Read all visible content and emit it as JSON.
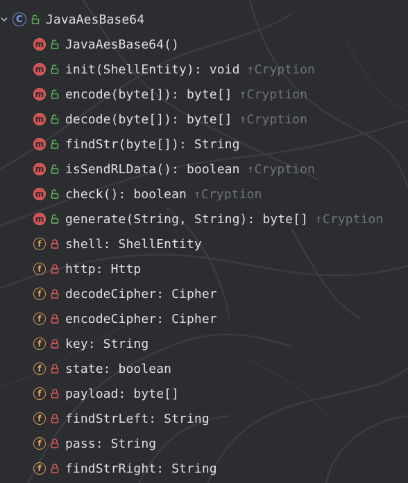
{
  "tree": {
    "root": {
      "label": "JavaAesBase64",
      "kind_icon": "class-icon",
      "visibility_icon": "public-icon",
      "expand_icon": "chevron-down-icon",
      "badge": "C"
    },
    "members": [
      {
        "label": "JavaAesBase64()",
        "super": "",
        "kind": "method",
        "visibility": "public"
      },
      {
        "label": "init(ShellEntity): void",
        "super": "↑Cryption",
        "kind": "method",
        "visibility": "public"
      },
      {
        "label": "encode(byte[]): byte[]",
        "super": "↑Cryption",
        "kind": "method",
        "visibility": "public"
      },
      {
        "label": "decode(byte[]): byte[]",
        "super": "↑Cryption",
        "kind": "method",
        "visibility": "public"
      },
      {
        "label": "findStr(byte[]): String",
        "super": "",
        "kind": "method",
        "visibility": "public"
      },
      {
        "label": "isSendRLData(): boolean",
        "super": "↑Cryption",
        "kind": "method",
        "visibility": "public"
      },
      {
        "label": "check(): boolean",
        "super": "↑Cryption",
        "kind": "method",
        "visibility": "public"
      },
      {
        "label": "generate(String, String): byte[]",
        "super": "↑Cryption",
        "kind": "method",
        "visibility": "public"
      },
      {
        "label": "shell: ShellEntity",
        "super": "",
        "kind": "field",
        "visibility": "private"
      },
      {
        "label": "http: Http",
        "super": "",
        "kind": "field",
        "visibility": "private"
      },
      {
        "label": "decodeCipher: Cipher",
        "super": "",
        "kind": "field",
        "visibility": "private"
      },
      {
        "label": "encodeCipher: Cipher",
        "super": "",
        "kind": "field",
        "visibility": "private"
      },
      {
        "label": "key: String",
        "super": "",
        "kind": "field",
        "visibility": "private"
      },
      {
        "label": "state: boolean",
        "super": "",
        "kind": "field",
        "visibility": "private"
      },
      {
        "label": "payload: byte[]",
        "super": "",
        "kind": "field",
        "visibility": "private"
      },
      {
        "label": "findStrLeft: String",
        "super": "",
        "kind": "field",
        "visibility": "private"
      },
      {
        "label": "pass: String",
        "super": "",
        "kind": "field",
        "visibility": "private"
      },
      {
        "label": "findStrRight: String",
        "super": "",
        "kind": "field",
        "visibility": "private"
      }
    ],
    "badges": {
      "method": "m",
      "field": "f"
    }
  },
  "colors": {
    "background": "#2b2d30",
    "text": "#dfe1e5",
    "super_text": "#6f737a",
    "method_badge": "#d2504f",
    "field_badge": "#d89a4f",
    "class_badge": "#6f8fd6",
    "public_lock": "#5fb85a",
    "private_lock": "#e0595a"
  }
}
